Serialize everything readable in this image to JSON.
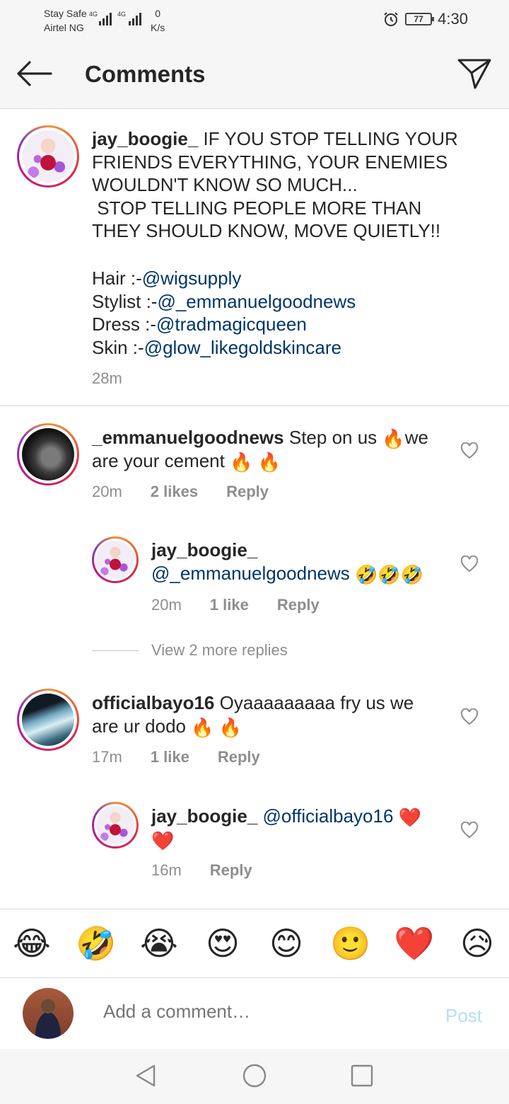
{
  "status_bar": {
    "carrier_line1": "Stay Safe",
    "carrier_line2": "Airtel NG",
    "network1": "4G",
    "network2": "4G",
    "speed_value": "0",
    "speed_unit": "K/s",
    "battery": "77",
    "time": "4:30"
  },
  "header": {
    "title": "Comments"
  },
  "post": {
    "username": "jay_boogie_",
    "caption_lines": [
      "IF YOU STOP TELLING YOUR",
      "FRIENDS EVERYTHING, YOUR ENEMIES",
      "WOULDN'T KNOW SO MUCH...",
      " STOP TELLING PEOPLE MORE THAN",
      "THEY SHOULD KNOW, MOVE QUIETLY!!"
    ],
    "credits": [
      {
        "label": "Hair :-",
        "mention": "@wigsupply"
      },
      {
        "label": "Stylist :-",
        "mention": "@_emmanuelgoodnews"
      },
      {
        "label": "Dress :-",
        "mention": "@tradmagicqueen"
      },
      {
        "label": "Skin :-",
        "mention": "@glow_likegoldskincare"
      }
    ],
    "time": "28m"
  },
  "comments": [
    {
      "username": "_emmanuelgoodnews",
      "text_a": "Step on us",
      "emoji_a": "🔥",
      "text_b": "we",
      "text_c": "are your cement",
      "emoji_b": "🔥 🔥",
      "time": "20m",
      "likes": "2 likes",
      "reply": "Reply"
    },
    {
      "username": "jay_boogie_",
      "mention": "@_emmanuelgoodnews",
      "emoji": "🤣🤣🤣",
      "time": "20m",
      "likes": "1 like",
      "reply": "Reply"
    },
    {
      "username": "officialbayo16",
      "text_a": "Oyaaaaaaaaa fry us we",
      "text_b": "are ur dodo",
      "emoji": "🔥 🔥",
      "time": "17m",
      "likes": "1 like",
      "reply": "Reply"
    },
    {
      "username": "jay_boogie_",
      "mention": "@officialbayo16",
      "emoji_a": "❤️",
      "emoji_b": "❤️",
      "time": "16m",
      "reply": "Reply"
    }
  ],
  "view_more_replies": "View 2 more replies",
  "emoji_bar": [
    "😂",
    "🤣",
    "😭",
    "😍",
    "😊",
    "🙂",
    "❤️",
    "😥"
  ],
  "composer": {
    "placeholder": "Add a comment…",
    "post_label": "Post"
  },
  "colors": {
    "mention": "#003569",
    "meta_gray": "#8e8e8e",
    "post_disabled": "#b2dffc"
  },
  "icons": [
    "back-arrow-icon",
    "direct-send-icon",
    "heart-outline-icon",
    "nav-back-icon",
    "nav-home-icon",
    "nav-recents-icon",
    "alarm-icon",
    "battery-icon",
    "signal-icon"
  ]
}
